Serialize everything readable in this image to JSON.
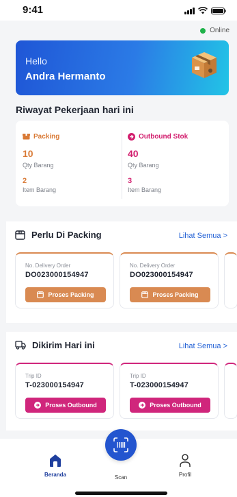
{
  "status_bar": {
    "time": "9:41"
  },
  "connection": {
    "status": "Online",
    "color": "#1fb24a"
  },
  "greeting": {
    "hello": "Hello",
    "name": "Andra Hermanto"
  },
  "today_work": {
    "title": "Riwayat Pekerjaan hari ini",
    "packing": {
      "label": "Packing",
      "qty": "10",
      "qty_label": "Qty Barang",
      "items": "2",
      "items_label": "Item Barang"
    },
    "outbound": {
      "label": "Outbound Stok",
      "qty": "40",
      "qty_label": "Qty Barang",
      "items": "3",
      "items_label": "Item Barang"
    }
  },
  "packing_section": {
    "title": "Perlu Di Packing",
    "see_all": "Lihat Semua >",
    "cards": [
      {
        "label": "No. Delivery Order",
        "value": "DO023000154947",
        "button": "Proses Packing"
      },
      {
        "label": "No. Delivery Order",
        "value": "DO023000154947",
        "button": "Proses Packing"
      }
    ]
  },
  "delivery_section": {
    "title": "Dikirim Hari ini",
    "see_all": "Lihat Semua >",
    "cards": [
      {
        "label": "Trip ID",
        "value": "T-023000154947",
        "button": "Proses Outbound"
      },
      {
        "label": "Trip ID",
        "value": "T-023000154947",
        "button": "Proses Outbound"
      }
    ]
  },
  "tab_bar": {
    "items": [
      {
        "label": "Beranda",
        "icon": "home-icon",
        "active": true
      },
      {
        "label": "Scan",
        "icon": "scan-icon",
        "active": false
      },
      {
        "label": "Profil",
        "icon": "profile-icon",
        "active": false
      }
    ]
  },
  "colors": {
    "primary": "#2355cf",
    "packing": "#d98a52",
    "outbound": "#d0267c",
    "link": "#2563d6"
  }
}
